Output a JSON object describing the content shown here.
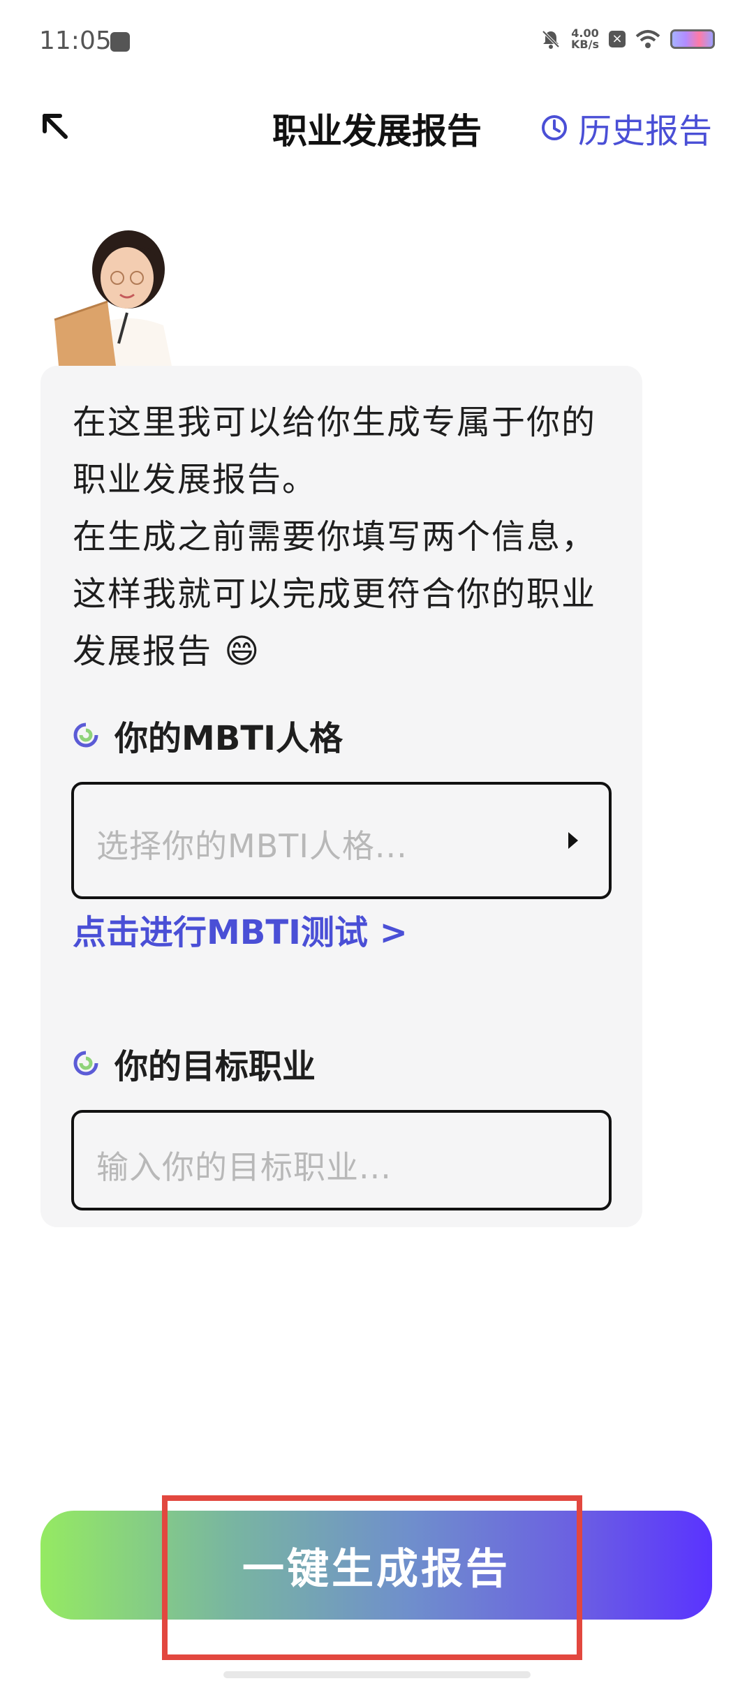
{
  "status_bar": {
    "time": "11:05",
    "speed_value": "4.00",
    "speed_unit": "KB/s"
  },
  "header": {
    "title": "职业发展报告",
    "history_label": "历史报告"
  },
  "intro": {
    "lines": [
      "在这里我可以给你生成专属于你的职业发展报告。",
      "在生成之前需要你填写两个信息，这样我就可以完成更符合你的职业发展报告 😄"
    ]
  },
  "mbti": {
    "label": "你的MBTI人格",
    "placeholder": "选择你的MBTI人格...",
    "test_link": "点击进行MBTI测试 >"
  },
  "career": {
    "label": "你的目标职业",
    "placeholder": "输入你的目标职业..."
  },
  "cta": {
    "label": "一键生成报告"
  },
  "colors": {
    "accent": "#4a4fd6",
    "highlight": "#e2473f",
    "gradient_start": "#95ea62",
    "gradient_end": "#5a33ff"
  }
}
